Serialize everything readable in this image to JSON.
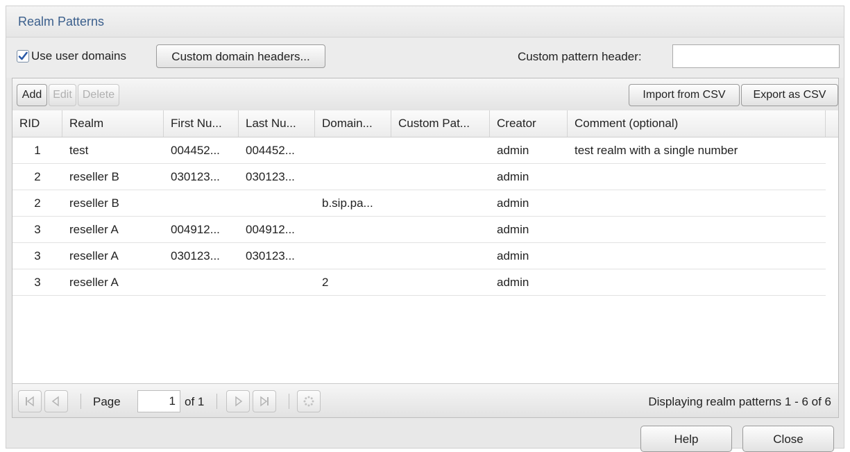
{
  "window": {
    "title": "Realm Patterns"
  },
  "options": {
    "use_user_domains_label": "Use user domains",
    "use_user_domains_checked": true,
    "custom_domain_headers_label": "Custom domain headers...",
    "custom_pattern_header_label": "Custom pattern header:",
    "custom_pattern_header_value": ""
  },
  "toolbar": {
    "add_label": "Add",
    "edit_label": "Edit",
    "delete_label": "Delete",
    "import_label": "Import from CSV",
    "export_label": "Export as CSV"
  },
  "table": {
    "columns": [
      "RID",
      "Realm",
      "First Nu...",
      "Last Nu...",
      "Domain...",
      "Custom Pat...",
      "Creator",
      "Comment (optional)"
    ],
    "rows": [
      [
        "1",
        "test",
        "004452...",
        "004452...",
        "",
        "",
        "admin",
        "test realm with a single number"
      ],
      [
        "2",
        "reseller B",
        "030123...",
        "030123...",
        "",
        "",
        "admin",
        ""
      ],
      [
        "2",
        "reseller B",
        "",
        "",
        "b.sip.pa...",
        "",
        "admin",
        ""
      ],
      [
        "3",
        "reseller A",
        "004912...",
        "004912...",
        "",
        "",
        "admin",
        ""
      ],
      [
        "3",
        "reseller A",
        "030123...",
        "030123...",
        "",
        "",
        "admin",
        ""
      ],
      [
        "3",
        "reseller A",
        "",
        "",
        "2",
        "",
        "admin",
        ""
      ]
    ]
  },
  "pager": {
    "page_label": "Page",
    "page_value": "1",
    "of_label": "of 1",
    "status": "Displaying realm patterns 1 - 6 of 6"
  },
  "footer": {
    "help_label": "Help",
    "close_label": "Close"
  },
  "colors": {
    "title": "#3b5f8c",
    "check": "#2a5aa8"
  }
}
